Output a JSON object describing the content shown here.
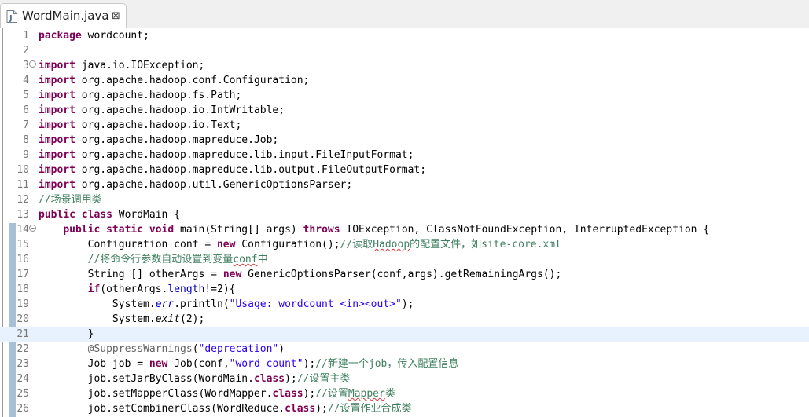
{
  "tab": {
    "title": "WordMain.java",
    "close_glyph": "⊠",
    "icon": "java-file-icon"
  },
  "line_numbers": [
    "1",
    "2",
    "3",
    "4",
    "5",
    "6",
    "7",
    "8",
    "9",
    "10",
    "11",
    "12",
    "13",
    "14",
    "15",
    "16",
    "17",
    "18",
    "19",
    "20",
    "21",
    "22",
    "23",
    "24",
    "25",
    "26"
  ],
  "current_line": "21",
  "colors": {
    "keyword": "#7f0055",
    "comment": "#3f7f5f",
    "string": "#2a00ff",
    "field": "#0000c0",
    "current_line_bg": "#e8f2fe"
  },
  "code": {
    "l1": [
      "package",
      " wordcount;"
    ],
    "l3": [
      "import",
      " java.io.IOException;"
    ],
    "l4": [
      "import",
      " org.apache.hadoop.conf.Configuration;"
    ],
    "l5": [
      "import",
      " org.apache.hadoop.fs.Path;"
    ],
    "l6": [
      "import",
      " org.apache.hadoop.io.IntWritable;"
    ],
    "l7": [
      "import",
      " org.apache.hadoop.io.Text;"
    ],
    "l8": [
      "import",
      " org.apache.hadoop.mapreduce.Job;"
    ],
    "l9": [
      "import",
      " org.apache.hadoop.mapreduce.lib.input.FileInputFormat;"
    ],
    "l10": [
      "import",
      " org.apache.hadoop.mapreduce.lib.output.FileOutputFormat;"
    ],
    "l11": [
      "import",
      " org.apache.hadoop.util.GenericOptionsParser;"
    ],
    "l12": [
      "//场景调用类"
    ],
    "l13": [
      "public",
      " ",
      "class",
      " WordMain {"
    ],
    "l14": [
      "    ",
      "public",
      " ",
      "static",
      " ",
      "void",
      " main(String[] args) ",
      "throws",
      " IOException, ClassNotFoundException, InterruptedException {"
    ],
    "l15": [
      "        Configuration conf = ",
      "new",
      " Configuration();",
      "//读取",
      "Hadoop",
      "的配置文件，如site-core.xml"
    ],
    "l16": [
      "        ",
      "//将命令行参数自动设置到变量",
      "conf",
      "中"
    ],
    "l17": [
      "        String [] otherArgs = ",
      "new",
      " GenericOptionsParser(conf,args).getRemainingArgs();"
    ],
    "l18": [
      "        ",
      "if",
      "(otherArgs.",
      "length",
      "!=2){"
    ],
    "l19": [
      "            System.",
      "err",
      ".println(",
      "\"Usage: wordcount <in><out>\"",
      ");"
    ],
    "l20": [
      "            System.",
      "exit",
      "(2);"
    ],
    "l21": [
      "        }"
    ],
    "l22": [
      "        ",
      "@SuppressWarnings",
      "(",
      "\"deprecation\"",
      ")"
    ],
    "l23": [
      "        Job job = ",
      "new",
      " ",
      "Job",
      "(conf,",
      "\"word count\"",
      ");",
      "//新建一个job，传入配置信息"
    ],
    "l24": [
      "        job.setJarByClass(WordMain.",
      "class",
      ");",
      "//设置主类"
    ],
    "l25": [
      "        job.setMapperClass(WordMapper.",
      "class",
      ");",
      "//设置",
      "Mapper",
      "类"
    ],
    "l26": [
      "        job.setCombinerClass(WordReduce.",
      "class",
      ");",
      "//设置作业合成类"
    ]
  }
}
